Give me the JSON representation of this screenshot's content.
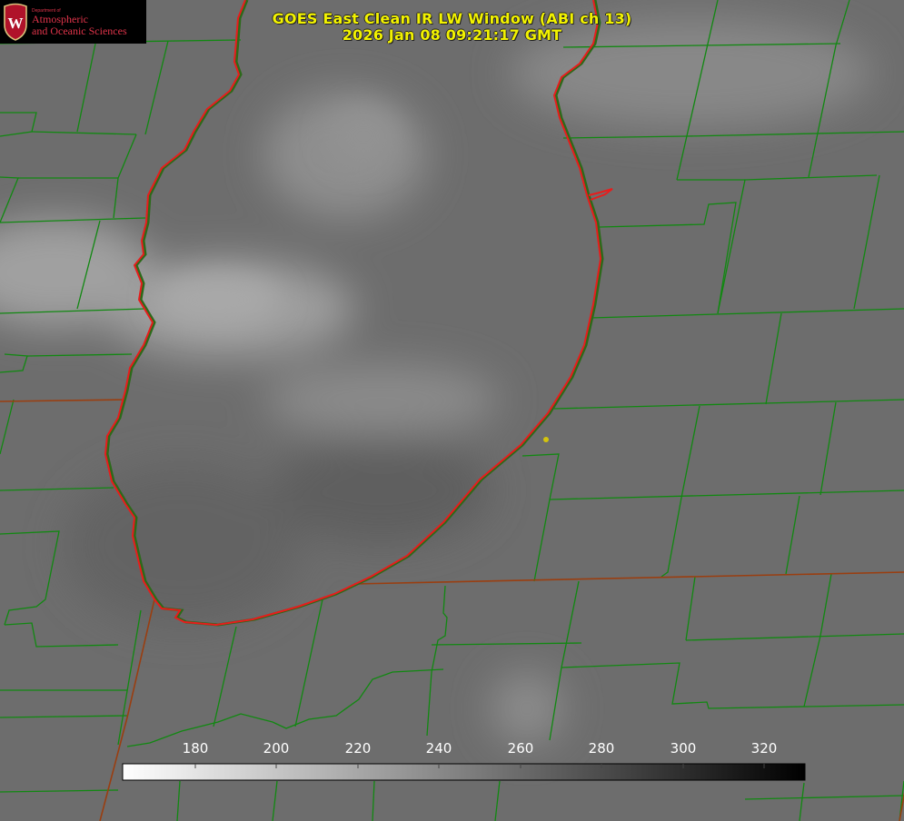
{
  "title": {
    "line1": "GOES East Clean IR LW Window (ABI ch 13)",
    "line2": "2026 Jan 08 09:21:17 GMT"
  },
  "logo": {
    "dept": "Department of",
    "line1": "Atmospheric",
    "line2": "and Oceanic Sciences",
    "seal_letter": "W"
  },
  "colorbar": {
    "ticks": [
      "180",
      "200",
      "220",
      "240",
      "260",
      "280",
      "300",
      "320"
    ],
    "range": [
      162,
      330
    ],
    "scale": "white (cold) to black (warm)"
  },
  "colors": {
    "county_lines": "#118811",
    "coastline": "#e81c1c",
    "state_lines": "#9a3e10",
    "marker": "#d4c40c",
    "title_text": "#f2f200",
    "logo_text": "#e0344a"
  }
}
